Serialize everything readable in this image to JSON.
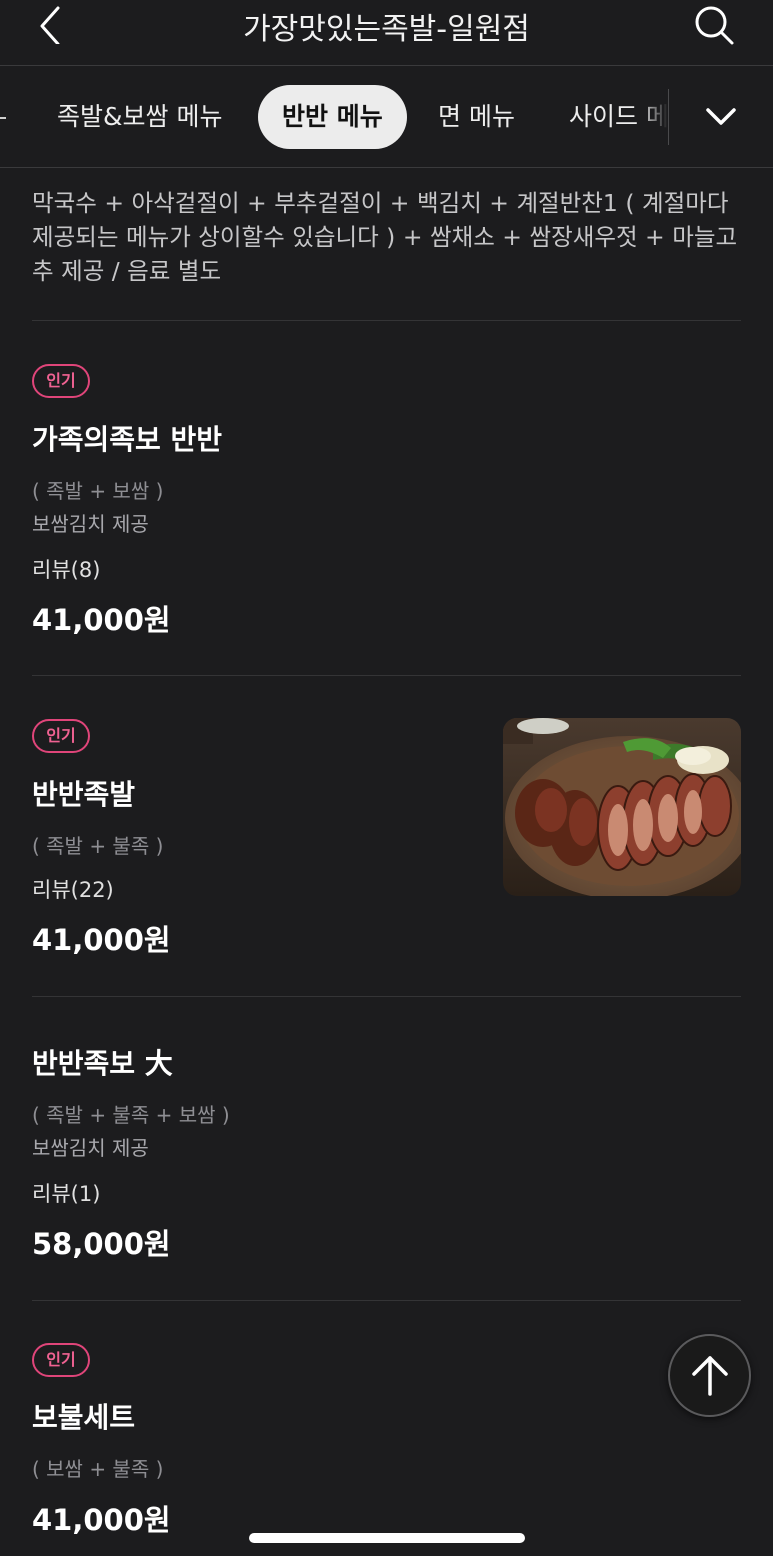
{
  "header": {
    "title": "가장맛있는족발-일원점"
  },
  "tabs": [
    {
      "label": "족발&보쌈 메뉴",
      "active": false
    },
    {
      "label": "반반 메뉴",
      "active": true
    },
    {
      "label": "면 메뉴",
      "active": false
    },
    {
      "label": "사이드 메",
      "active": false
    }
  ],
  "description": "막국수 + 아삭겉절이 + 부추겉절이 + 백김치 + 계절반찬1 ( 계절마다 제공되는 메뉴가 상이할수 있습니다 ) + 쌈채소 + 쌈장새우젓 + 마늘고추 제공 / 음료 별도",
  "items": [
    {
      "badge": "인기",
      "name": "가족의족보 반반",
      "sub": "( 족발 + 보쌈 )",
      "note": "보쌈김치 제공",
      "review": "리뷰(8)",
      "price": "41,000원"
    },
    {
      "badge": "인기",
      "name": "반반족발",
      "sub": "( 족발 + 불족 )",
      "review": "리뷰(22)",
      "price": "41,000원"
    },
    {
      "name": "반반족보 大",
      "sub": "( 족발 + 불족 + 보쌈 )",
      "note": "보쌈김치 제공",
      "review": "리뷰(1)",
      "price": "58,000원"
    },
    {
      "badge": "인기",
      "name": "보불세트",
      "sub": "( 보쌈 + 불족 )",
      "price": "41,000원"
    }
  ],
  "icons": {
    "back": "chevron-left-icon",
    "search": "search-icon",
    "expand": "chevron-down-icon",
    "scroll_top": "arrow-up-icon"
  },
  "colors": {
    "background": "#1c1c1e",
    "badge": "#e0457a",
    "active_tab": "#ececec"
  }
}
